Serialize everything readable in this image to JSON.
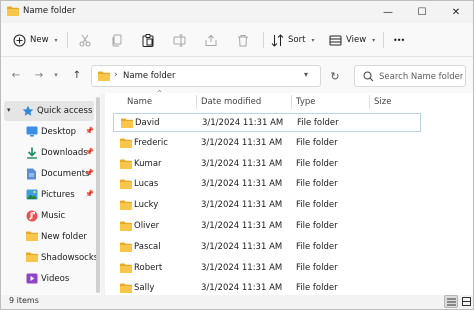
{
  "window": {
    "title": "Name folder",
    "controls": {
      "minimize": "—",
      "maximize": "☐",
      "close": "✕"
    }
  },
  "command_bar": {
    "new_label": "New",
    "sort_label": "Sort",
    "view_label": "View",
    "more_label": "•••"
  },
  "address_bar": {
    "path": [
      "Name folder"
    ],
    "search_placeholder": "Search Name folder"
  },
  "sidebar": {
    "items": [
      {
        "label": "Quick access",
        "icon": "star-icon",
        "selected": true,
        "pinned": false
      },
      {
        "label": "Desktop",
        "icon": "desktop-icon",
        "pinned": true
      },
      {
        "label": "Downloads",
        "icon": "download-icon",
        "pinned": true
      },
      {
        "label": "Documents",
        "icon": "document-icon",
        "pinned": true
      },
      {
        "label": "Pictures",
        "icon": "picture-icon",
        "pinned": true
      },
      {
        "label": "Music",
        "icon": "music-icon",
        "pinned": false
      },
      {
        "label": "New folder",
        "icon": "folder-icon",
        "pinned": false
      },
      {
        "label": "ShadowsocksR",
        "icon": "folder-icon",
        "pinned": false
      },
      {
        "label": "Videos",
        "icon": "video-icon",
        "pinned": false
      }
    ]
  },
  "file_list": {
    "columns": [
      "Name",
      "Date modified",
      "Type",
      "Size"
    ],
    "sorted_by": "Name",
    "rows": [
      {
        "name": "David",
        "date": "3/1/2024 11:31 AM",
        "type": "File folder",
        "size": ""
      },
      {
        "name": "Frederic",
        "date": "3/1/2024 11:31 AM",
        "type": "File folder",
        "size": ""
      },
      {
        "name": "Kumar",
        "date": "3/1/2024 11:31 AM",
        "type": "File folder",
        "size": ""
      },
      {
        "name": "Lucas",
        "date": "3/1/2024 11:31 AM",
        "type": "File folder",
        "size": ""
      },
      {
        "name": "Lucky",
        "date": "3/1/2024 11:31 AM",
        "type": "File folder",
        "size": ""
      },
      {
        "name": "Oliver",
        "date": "3/1/2024 11:31 AM",
        "type": "File folder",
        "size": ""
      },
      {
        "name": "Pascal",
        "date": "3/1/2024 11:31 AM",
        "type": "File folder",
        "size": ""
      },
      {
        "name": "Robert",
        "date": "3/1/2024 11:31 AM",
        "type": "File folder",
        "size": ""
      },
      {
        "name": "Sally",
        "date": "3/1/2024 11:31 AM",
        "type": "File folder",
        "size": ""
      }
    ]
  },
  "status_bar": {
    "item_count": "9 items"
  },
  "colors": {
    "folder": "#f8c64a",
    "folder_dark": "#e7a92a",
    "accent": "#0067c0",
    "focus_border": "#b9d3ec"
  }
}
